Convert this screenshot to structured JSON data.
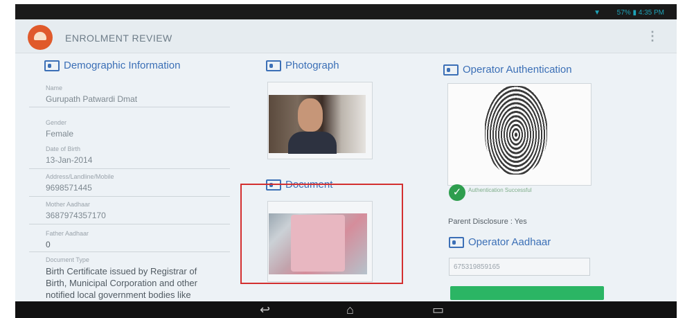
{
  "status_bar": {
    "wifi_icon": "wifi-icon",
    "text": "57% ▮ 4:35 PM"
  },
  "app": {
    "title": "ENROLMENT REVIEW",
    "logo_icon": "aadhaar-logo-icon",
    "menu_icon": "overflow-menu-icon"
  },
  "demographic": {
    "title": "Demographic Information",
    "fields": [
      {
        "label": "Name",
        "value": "Gurupath Patwardi Dmat"
      },
      {
        "label": "Gender",
        "value": "Female"
      },
      {
        "label": "Date of Birth",
        "value": "13-Jan-2014"
      },
      {
        "label": "Address/Landline/Mobile",
        "value": "9698571445"
      },
      {
        "label": "Mother Aadhaar",
        "value": "3687974357170"
      },
      {
        "label": "Father Aadhaar",
        "value": "0"
      }
    ],
    "document_type_label": "Document Type",
    "document_type_lines": [
      "Birth Certificate issued by Registrar of",
      "Birth, Municipal Corporation and other",
      "notified local government bodies like"
    ]
  },
  "photograph": {
    "title": "Photograph"
  },
  "document": {
    "title": "Document"
  },
  "operator": {
    "auth_title": "Operator Authentication",
    "auth_status": "Authentication Successful",
    "parent_disclosure": "Parent Disclosure : Yes",
    "aadhaar_title": "Operator Aadhaar",
    "aadhaar_value": "675319859165"
  },
  "nav": {
    "back": "↩",
    "home": "⌂",
    "recents": "▭"
  },
  "colors": {
    "accent": "#3b6fb6",
    "success": "#2e9e4e",
    "highlight": "#d32f2f"
  }
}
